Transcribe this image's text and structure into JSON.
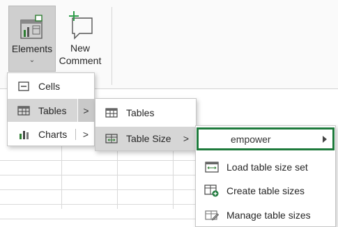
{
  "ribbon": {
    "elements_label": "Elements",
    "elements_caret": "⌄",
    "comment_label_line1": "New",
    "comment_label_line2": "Comment"
  },
  "menu_l1": {
    "items": [
      {
        "label": "Cells",
        "icon": "cells-icon"
      },
      {
        "label": "Tables",
        "icon": "table-icon",
        "arrow": ">"
      },
      {
        "label": "Charts",
        "icon": "bar-chart-icon",
        "arrow": ">"
      }
    ]
  },
  "menu_l2": {
    "items": [
      {
        "label": "Tables",
        "icon": "table-icon"
      },
      {
        "label": "Table Size",
        "icon": "table-size-icon",
        "arrow": ">"
      }
    ]
  },
  "menu_l3": {
    "empower_label": "empower",
    "items": [
      {
        "label": "Load table size set",
        "icon": "load-table-size-icon"
      },
      {
        "label": "Create table sizes",
        "icon": "create-table-size-icon"
      },
      {
        "label": "Manage table sizes",
        "icon": "manage-table-size-icon"
      }
    ]
  },
  "colors": {
    "accent_green": "#1e7a3c",
    "active_item_bg": "#d6d6d6"
  }
}
